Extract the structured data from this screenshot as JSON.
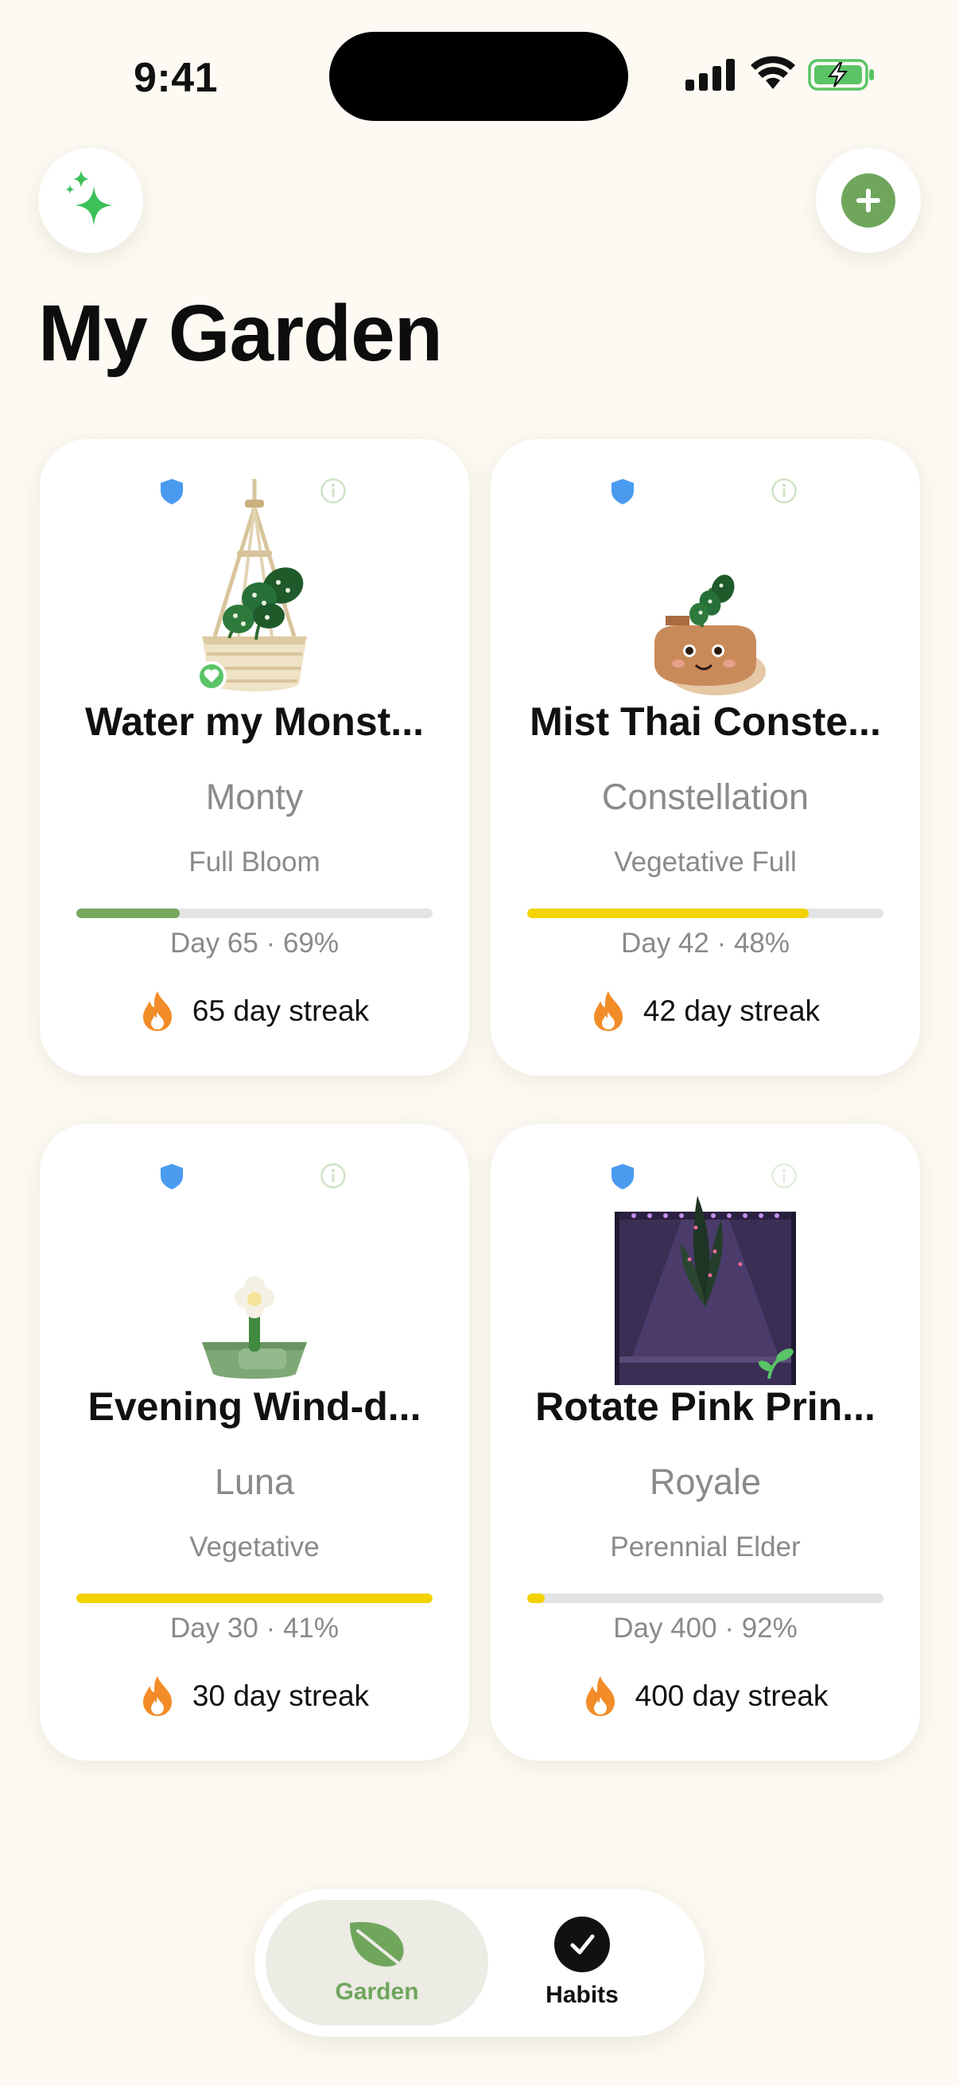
{
  "status_bar": {
    "time": "9:41"
  },
  "header": {
    "title": "My Garden"
  },
  "colors": {
    "accent_green": "#6fa65c",
    "shield_blue": "#4a9bf0",
    "progress_yellow": "#f2d200",
    "flame_orange": "#f28c28"
  },
  "cards": [
    {
      "title": "Water my Monst...",
      "name": "Monty",
      "stage": "Full Bloom",
      "progress_text": "Day 65 · 69%",
      "progress": 0.29,
      "progress_color": "#76a860",
      "streak": "65 day streak",
      "art": "hanging-basket-plant",
      "favorite": true
    },
    {
      "title": "Mist Thai Conste...",
      "name": "Constellation",
      "stage": "Vegetative Full",
      "progress_text": "Day 42 · 48%",
      "progress": 0.79,
      "progress_color": "#f2d200",
      "streak": "42 day streak",
      "art": "smiling-pot-plant",
      "favorite": false
    },
    {
      "title": "Evening Wind-d...",
      "name": "Luna",
      "stage": "Vegetative",
      "progress_text": "Day 30 · 41%",
      "progress": 1.0,
      "progress_color": "#f2d200",
      "streak": "30 day streak",
      "art": "bowl-sprout-plant",
      "favorite": false
    },
    {
      "title": "Rotate Pink Prin...",
      "name": "Royale",
      "stage": "Perennial Elder",
      "progress_text": "Day 400 · 92%",
      "progress": 0.05,
      "progress_color": "#f2d200",
      "streak": "400 day streak",
      "art": "grow-tent-plant",
      "favorite": false
    }
  ],
  "tab_bar": {
    "tabs": [
      {
        "label": "Garden",
        "icon": "leaf-icon",
        "selected": true
      },
      {
        "label": "Habits",
        "icon": "checkmark-icon",
        "selected": false
      }
    ]
  }
}
